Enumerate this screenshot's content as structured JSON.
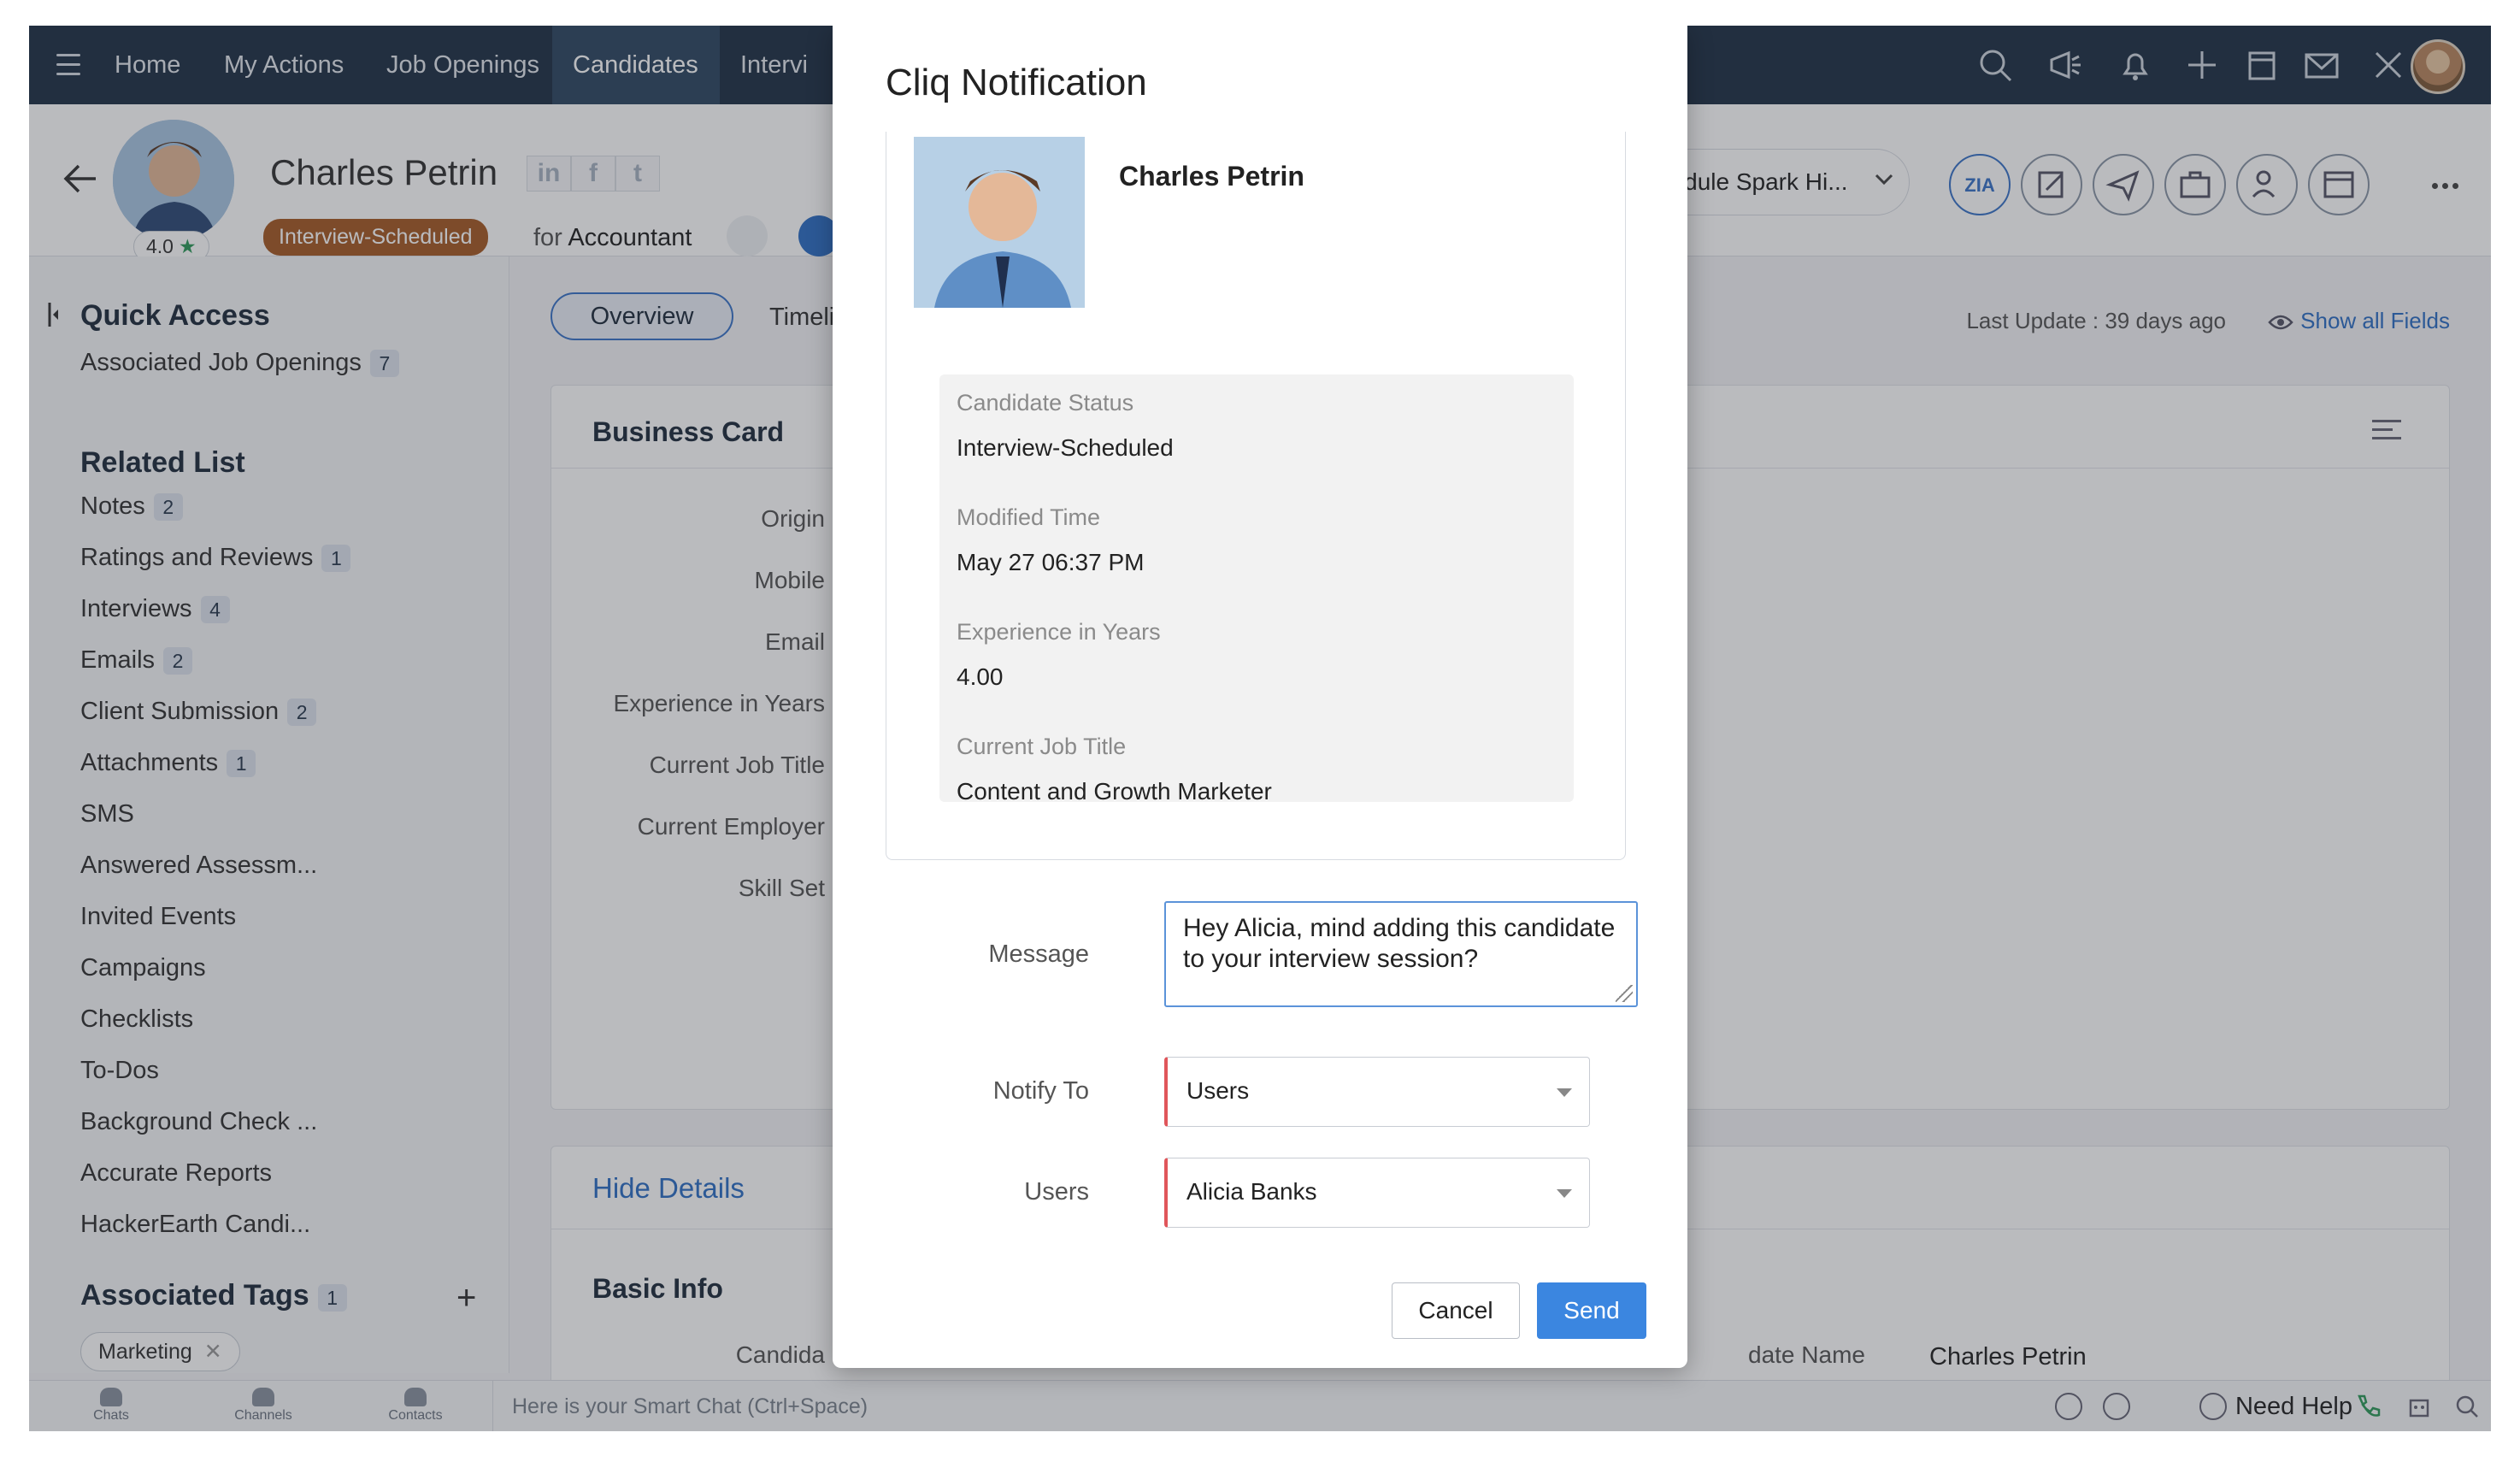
{
  "nav": {
    "items": [
      {
        "label": "Home"
      },
      {
        "label": "My Actions"
      },
      {
        "label": "Job Openings"
      },
      {
        "label": "Candidates"
      },
      {
        "label": "Intervi"
      }
    ],
    "icons": [
      "search-icon",
      "megaphone-icon",
      "bell-icon",
      "plus-icon",
      "calendar-icon",
      "mail-icon",
      "tools-icon"
    ]
  },
  "candidate": {
    "name": "Charles Petrin",
    "rating": "4.0",
    "status": "Interview-Scheduled",
    "for_prefix": "for",
    "job": "Accountant",
    "schedule_action": "hedule Spark Hi...",
    "social": [
      "in",
      "f",
      "t"
    ]
  },
  "sidebar": {
    "quick_access": "Quick Access",
    "associated_job_openings": {
      "label": "Associated Job Openings",
      "count": "7"
    },
    "related_list_title": "Related List",
    "related": [
      {
        "label": "Notes",
        "count": "2"
      },
      {
        "label": "Ratings and Reviews",
        "count": "1"
      },
      {
        "label": "Interviews",
        "count": "4"
      },
      {
        "label": "Emails",
        "count": "2"
      },
      {
        "label": "Client Submission",
        "count": "2"
      },
      {
        "label": "Attachments",
        "count": "1"
      },
      {
        "label": "SMS",
        "count": ""
      },
      {
        "label": "Answered Assessm...",
        "count": ""
      },
      {
        "label": "Invited Events",
        "count": ""
      },
      {
        "label": "Campaigns",
        "count": ""
      },
      {
        "label": "Checklists",
        "count": ""
      },
      {
        "label": "To-Dos",
        "count": ""
      },
      {
        "label": "Background Check ...",
        "count": ""
      },
      {
        "label": "Accurate Reports",
        "count": ""
      },
      {
        "label": "HackerEarth Candi...",
        "count": ""
      }
    ],
    "tags_title": "Associated Tags",
    "tags_count": "1",
    "tags": [
      "Marketing"
    ]
  },
  "main": {
    "tabs": [
      "Overview",
      "Timeli"
    ],
    "last_update": "Last Update : 39 days ago",
    "show_all_fields": "Show all Fields",
    "business_card_title": "Business Card",
    "business_fields": [
      "Origin",
      "Mobile",
      "Email",
      "Experience in Years",
      "Current Job Title",
      "Current Employer",
      "Skill Set"
    ],
    "hide_details": "Hide Details",
    "basic_info_title": "Basic Info",
    "basic_left_label": "Candida",
    "basic_right_label": "date Name",
    "basic_right_value": "Charles Petrin"
  },
  "bottombar": {
    "chats": "Chats",
    "channels": "Channels",
    "contacts": "Contacts",
    "smart_chat": "Here is your Smart Chat (Ctrl+Space)",
    "need_help": "Need Help"
  },
  "modal": {
    "title": "Cliq Notification",
    "card_name": "Charles Petrin",
    "fields": [
      {
        "label": "Candidate Status",
        "value": "Interview-Scheduled"
      },
      {
        "label": "Modified Time",
        "value": "May 27 06:37 PM"
      },
      {
        "label": "Experience in Years",
        "value": "4.00"
      },
      {
        "label": "Current Job Title",
        "value": "Content and Growth Marketer"
      }
    ],
    "message_label": "Message",
    "message_value": "Hey Alicia, mind adding this candidate to your interview session?",
    "notify_label": "Notify To",
    "notify_value": "Users",
    "users_label": "Users",
    "users_value": "Alicia Banks",
    "cancel_label": "Cancel",
    "send_label": "Send"
  },
  "colors": {
    "nav_bg": "#1f3146",
    "accent": "#3b86e0",
    "status_badge": "#a55a26",
    "required_marker": "#e0565b"
  }
}
